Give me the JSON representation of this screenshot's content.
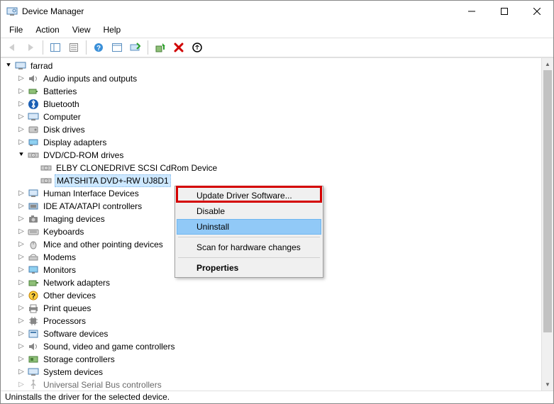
{
  "window": {
    "title": "Device Manager"
  },
  "menubar": {
    "file": "File",
    "action": "Action",
    "view": "View",
    "help": "Help"
  },
  "tree": {
    "root": "farrad",
    "audio": "Audio inputs and outputs",
    "batteries": "Batteries",
    "bluetooth": "Bluetooth",
    "computer": "Computer",
    "disk": "Disk drives",
    "display": "Display adapters",
    "dvd": "DVD/CD-ROM drives",
    "dvd_child1": "ELBY CLONEDRIVE SCSI CdRom Device",
    "dvd_child2": "MATSHITA DVD+-RW UJ8D1",
    "hid": "Human Interface Devices",
    "ide": "IDE ATA/ATAPI controllers",
    "imaging": "Imaging devices",
    "keyboards": "Keyboards",
    "mice": "Mice and other pointing devices",
    "modems": "Modems",
    "monitors": "Monitors",
    "network": "Network adapters",
    "other": "Other devices",
    "print": "Print queues",
    "processors": "Processors",
    "software": "Software devices",
    "sound": "Sound, video and game controllers",
    "storage": "Storage controllers",
    "system": "System devices",
    "usb": "Universal Serial Bus controllers"
  },
  "context_menu": {
    "update": "Update Driver Software...",
    "disable": "Disable",
    "uninstall": "Uninstall",
    "scan": "Scan for hardware changes",
    "properties": "Properties"
  },
  "statusbar": {
    "text": "Uninstalls the driver for the selected device."
  }
}
